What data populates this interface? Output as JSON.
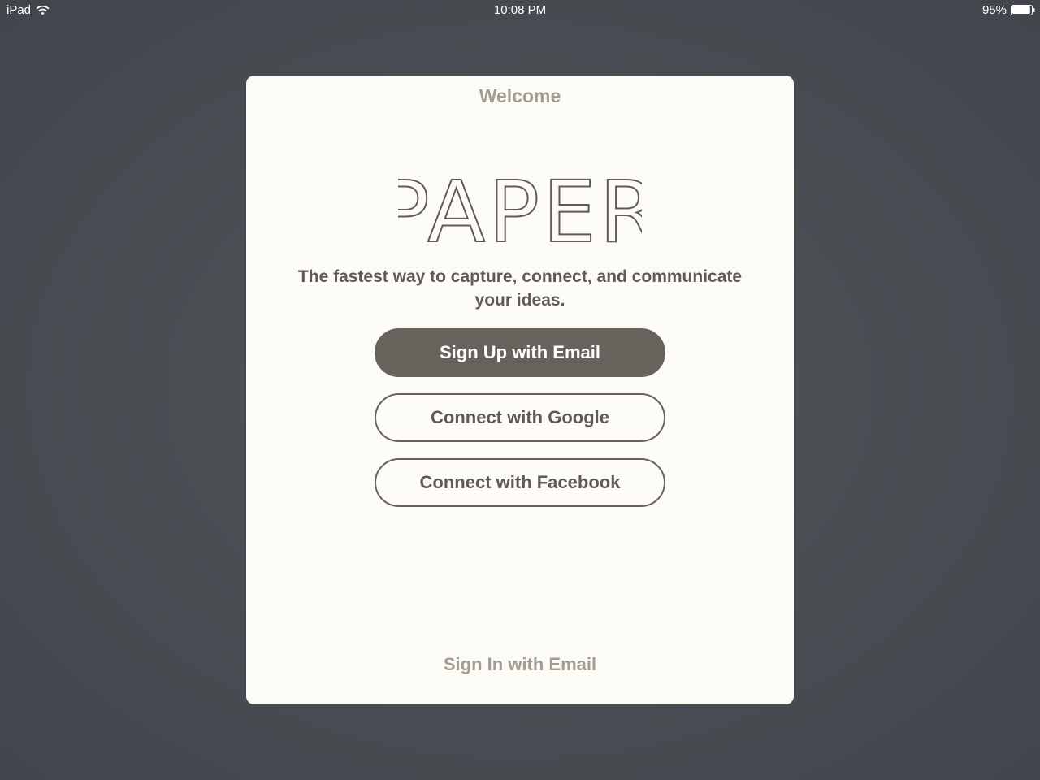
{
  "status_bar": {
    "device": "iPad",
    "time": "10:08 PM",
    "battery_percent": "95%",
    "battery_level": 0.95,
    "wifi_icon": "wifi-icon",
    "battery_icon": "battery-icon"
  },
  "card": {
    "title": "Welcome",
    "logo_text": "PAPER",
    "tagline": "The fastest way to capture, connect, and communicate your ideas.",
    "buttons": {
      "signup_email": "Sign Up with Email",
      "connect_google": "Connect with Google",
      "connect_facebook": "Connect with Facebook"
    },
    "signin_link": "Sign In with Email"
  },
  "colors": {
    "background": "#4a4f54",
    "card": "#fdfbf5",
    "primary_button": "#67625c",
    "text_dark": "#5f5a54",
    "text_muted": "#a19d92"
  }
}
